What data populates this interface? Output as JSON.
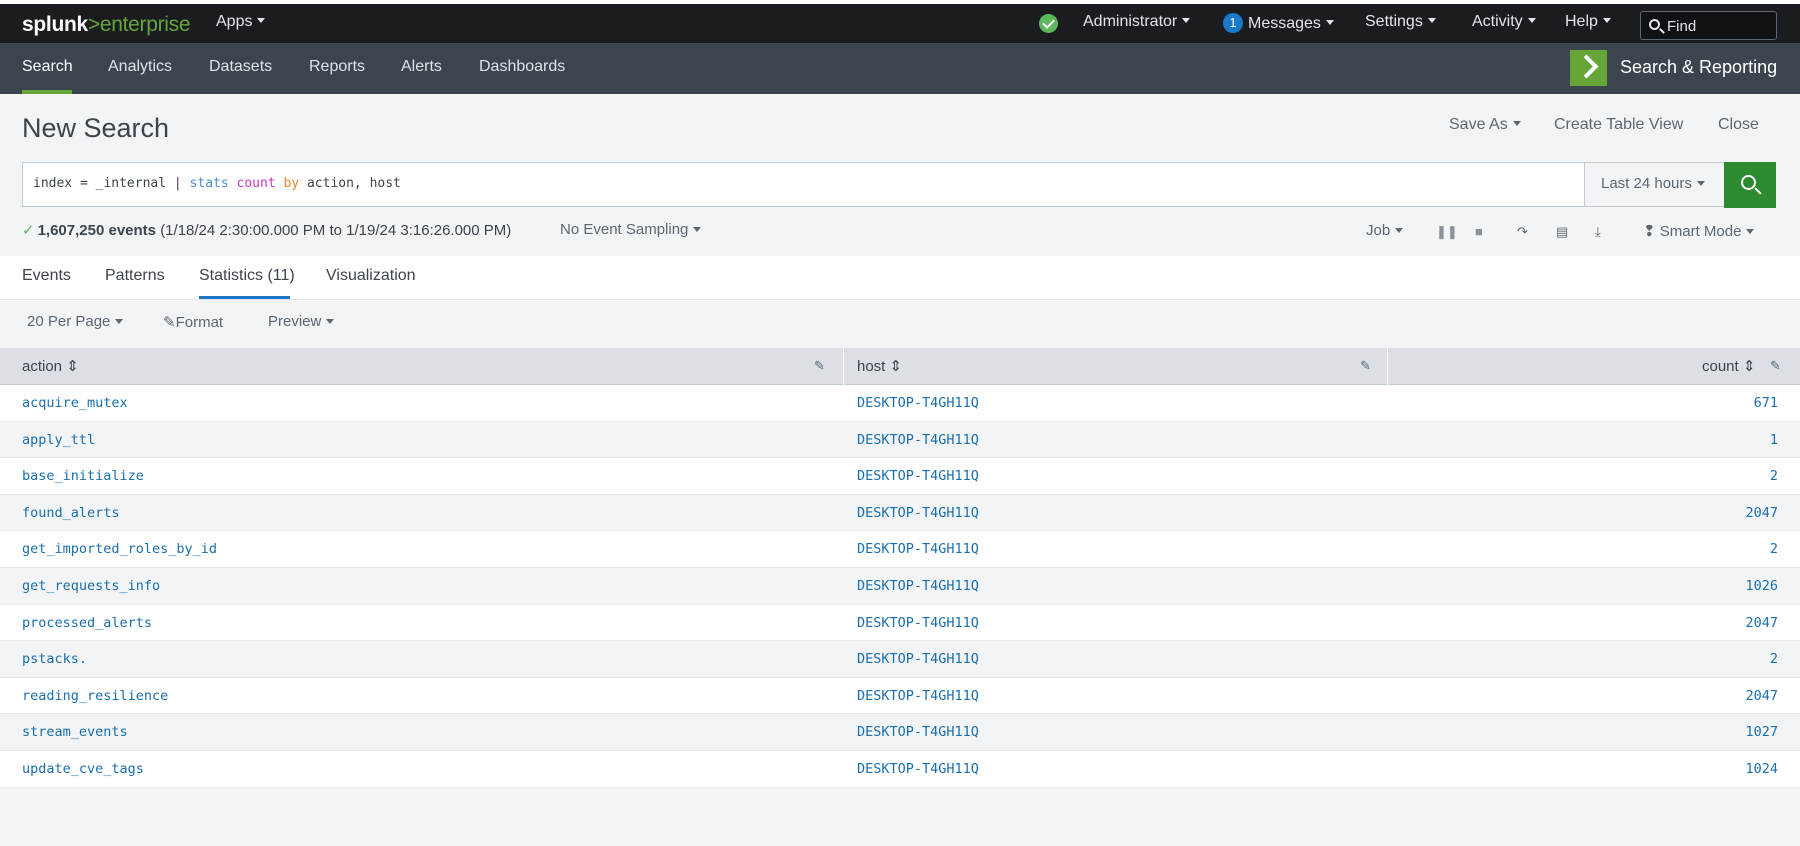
{
  "topbar": {
    "logo_main": "splunk",
    "logo_sep": ">",
    "logo_product": "enterprise",
    "apps_label": "Apps",
    "user_label": "Administrator",
    "messages_count": "1",
    "messages_label": "Messages",
    "settings_label": "Settings",
    "activity_label": "Activity",
    "help_label": "Help",
    "find_placeholder": "Find"
  },
  "appbar": {
    "nav": [
      "Search",
      "Analytics",
      "Datasets",
      "Reports",
      "Alerts",
      "Dashboards"
    ],
    "active_nav": "Search",
    "app_name": "Search & Reporting"
  },
  "page": {
    "title": "New Search",
    "save_as": "Save As",
    "create_table_view": "Create Table View",
    "close": "Close"
  },
  "search": {
    "query_parts": {
      "p1": "index = _internal | ",
      "p2": "stats",
      "p3": " ",
      "p4": "count",
      "p5": " ",
      "p6": "by",
      "p7": " action, host"
    },
    "time_range": "Last 24 hours"
  },
  "status": {
    "check": "✓",
    "event_count": "1,607,250 events",
    "range": "(1/18/24 2:30:00.000 PM to 1/19/24 3:16:26.000 PM)",
    "sampling": "No Event Sampling",
    "job": "Job",
    "mode": "Smart Mode"
  },
  "tabs": [
    "Events",
    "Patterns",
    "Statistics (11)",
    "Visualization"
  ],
  "active_tab": "Statistics (11)",
  "table_controls": {
    "per_page": "20 Per Page",
    "format": "Format",
    "preview": "Preview"
  },
  "table": {
    "columns": [
      "action",
      "host",
      "count"
    ],
    "rows": [
      {
        "action": "acquire_mutex",
        "host": "DESKTOP-T4GH11Q",
        "count": "671"
      },
      {
        "action": "apply_ttl",
        "host": "DESKTOP-T4GH11Q",
        "count": "1"
      },
      {
        "action": "base_initialize",
        "host": "DESKTOP-T4GH11Q",
        "count": "2"
      },
      {
        "action": "found_alerts",
        "host": "DESKTOP-T4GH11Q",
        "count": "2047"
      },
      {
        "action": "get_imported_roles_by_id",
        "host": "DESKTOP-T4GH11Q",
        "count": "2"
      },
      {
        "action": "get_requests_info",
        "host": "DESKTOP-T4GH11Q",
        "count": "1026"
      },
      {
        "action": "processed_alerts",
        "host": "DESKTOP-T4GH11Q",
        "count": "2047"
      },
      {
        "action": "pstacks.",
        "host": "DESKTOP-T4GH11Q",
        "count": "2"
      },
      {
        "action": "reading_resilience",
        "host": "DESKTOP-T4GH11Q",
        "count": "2047"
      },
      {
        "action": "stream_events",
        "host": "DESKTOP-T4GH11Q",
        "count": "1027"
      },
      {
        "action": "update_cve_tags",
        "host": "DESKTOP-T4GH11Q",
        "count": "1024"
      }
    ]
  },
  "colors": {
    "accent_green": "#65a637",
    "search_button": "#2c8a2f",
    "link_blue": "#1a6faf",
    "tab_underline": "#1a7ac9"
  }
}
